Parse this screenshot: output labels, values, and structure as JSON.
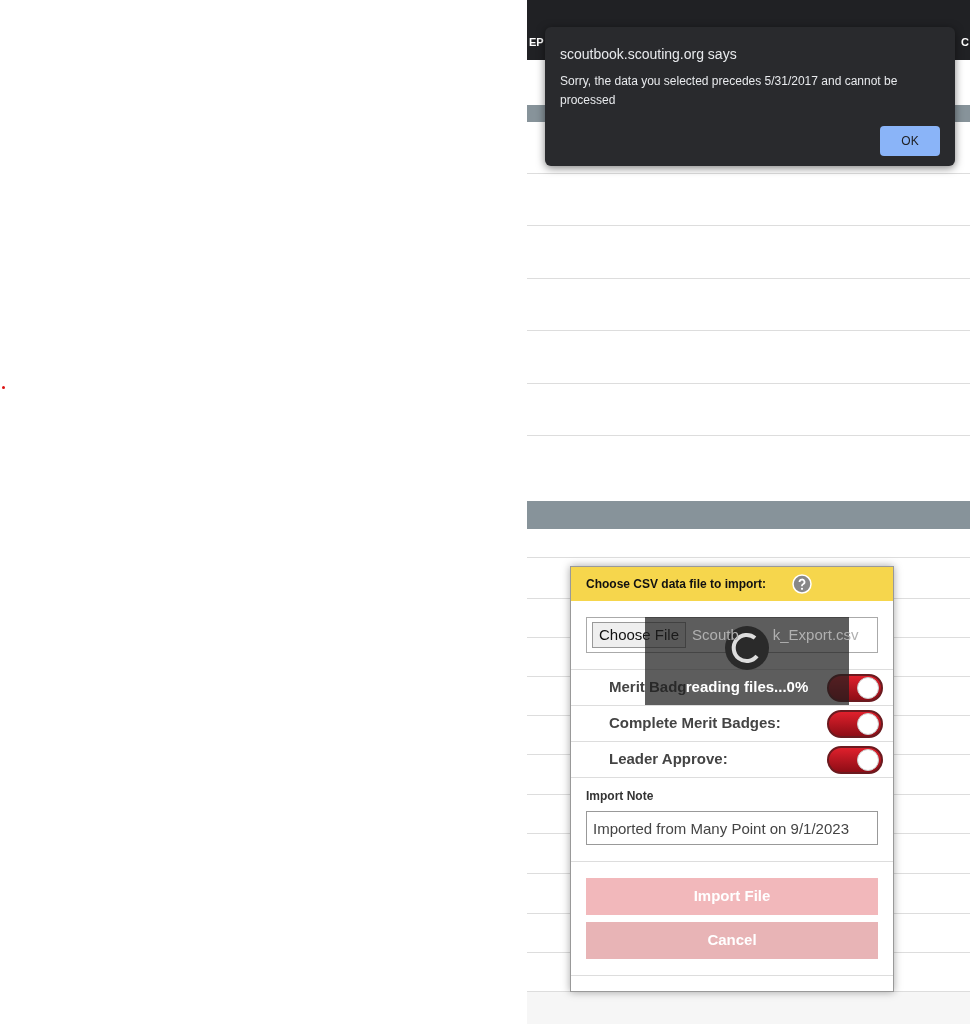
{
  "browser_bar": {
    "left_text": "EP",
    "right_text": "C"
  },
  "alert": {
    "origin": "scoutbook.scouting.org says",
    "message": "Sorry, the data you selected precedes 5/31/2017 and cannot be processed",
    "ok_button": "OK"
  },
  "import_dialog": {
    "title": "Choose CSV data file to import:",
    "file_button": "Choose File",
    "file_name_parts": [
      "Scoutb",
      "k_Export.csv"
    ],
    "toggles": [
      {
        "label": "Merit Badg",
        "on": true
      },
      {
        "label": "Complete Merit Badges:",
        "on": true
      },
      {
        "label": "Leader Approve:",
        "on": true
      }
    ],
    "note_label": "Import Note",
    "note_value": "Imported from Many Point on 9/1/2023",
    "buttons": [
      {
        "label": "Import File",
        "disabled": true
      },
      {
        "label": "Cancel",
        "disabled": true
      }
    ],
    "loading": {
      "text": "reading files...0%"
    }
  }
}
